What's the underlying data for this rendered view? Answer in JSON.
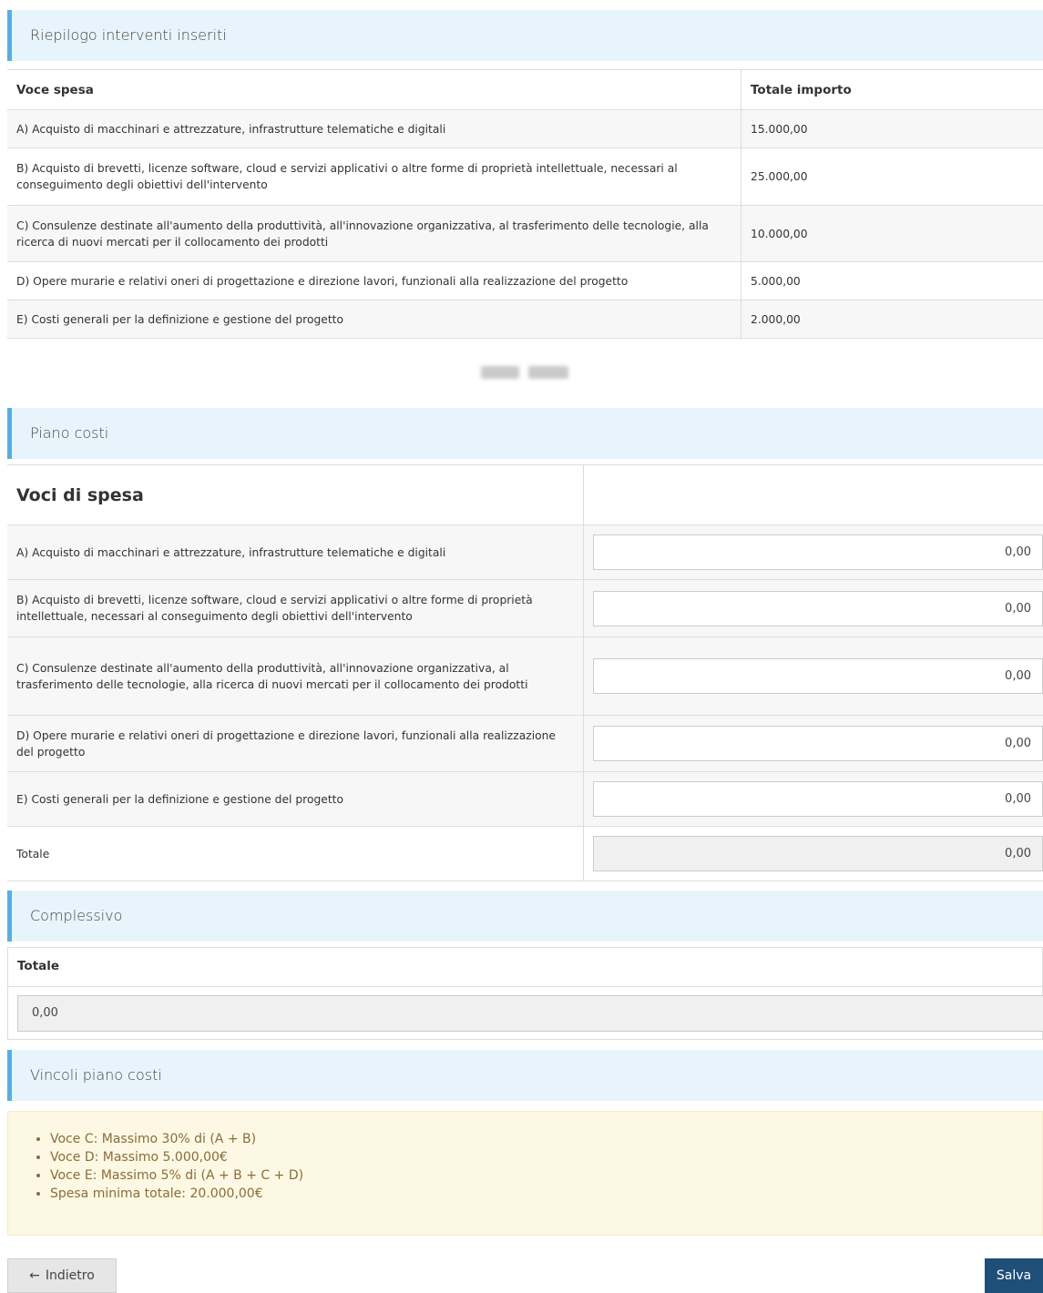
{
  "riepilogo": {
    "title": "Riepilogo interventi inseriti",
    "headers": [
      "Voce spesa",
      "Totale importo"
    ],
    "rows": [
      {
        "voce": "A) Acquisto di macchinari e attrezzature, infrastrutture telematiche e digitali",
        "importo": "15.000,00"
      },
      {
        "voce": "B) Acquisto di brevetti, licenze software, cloud e servizi applicativi o altre forme di proprietà intellettuale, necessari al conseguimento degli obiettivi dell'intervento",
        "importo": "25.000,00"
      },
      {
        "voce": "C) Consulenze destinate all'aumento della produttività, all'innovazione organizzativa, al trasferimento delle tecnologie, alla ricerca di nuovi mercati per il collocamento dei prodotti",
        "importo": "10.000,00"
      },
      {
        "voce": "D) Opere murarie e relativi oneri di progettazione e direzione lavori, funzionali alla realizzazione del progetto",
        "importo": "5.000,00"
      },
      {
        "voce": "E) Costi generali per la definizione e gestione del progetto",
        "importo": "2.000,00"
      }
    ]
  },
  "piano": {
    "title": "Piano costi",
    "header": "Voci di spesa",
    "rows": [
      {
        "voce": "A) Acquisto di macchinari e attrezzature, infrastrutture telematiche e digitali",
        "value": "0,00"
      },
      {
        "voce": "B) Acquisto di brevetti, licenze software, cloud e servizi applicativi o altre forme di proprietà intellettuale, necessari al conseguimento degli obiettivi dell'intervento",
        "value": "0,00"
      },
      {
        "voce": "C) Consulenze destinate all'aumento della produttività, all'innovazione organizzativa, al trasferimento delle tecnologie, alla ricerca di nuovi mercati per il collocamento dei prodotti",
        "value": "0,00"
      },
      {
        "voce": "D) Opere murarie e relativi oneri di progettazione e direzione lavori, funzionali alla realizzazione del progetto",
        "value": "0,00"
      },
      {
        "voce": "E) Costi generali per la definizione e gestione del progetto",
        "value": "0,00"
      }
    ],
    "total_label": "Totale",
    "total_value": "0,00"
  },
  "complessivo": {
    "title": "Complessivo",
    "label": "Totale",
    "value": "0,00"
  },
  "vincoli": {
    "title": "Vincoli piano costi",
    "items": [
      "Voce C: Massimo 30% di (A + B)",
      "Voce D: Massimo 5.000,00€",
      "Voce E: Massimo 5% di (A + B + C + D)",
      "Spesa minima totale: 20.000,00€"
    ]
  },
  "buttons": {
    "back_label": "Indietro",
    "save_label": "Salva"
  }
}
